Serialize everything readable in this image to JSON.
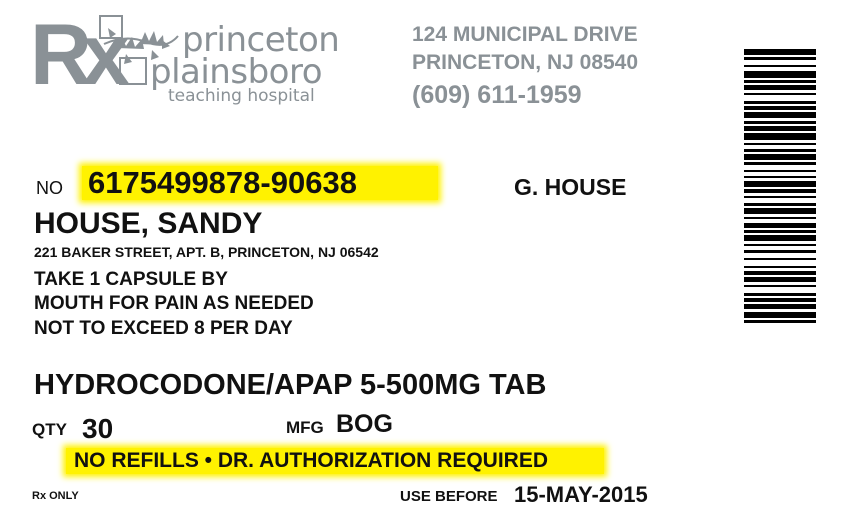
{
  "header": {
    "logo_rx": "Rx",
    "logo_line1": "princeton",
    "logo_line2": "plainsboro",
    "logo_line3": "teaching hospital",
    "address_line1": "124 MUNICIPAL DRIVE",
    "address_line2": "PRINCETON, NJ 08540",
    "phone": "(609) 611-1959"
  },
  "rx": {
    "no_label": "NO",
    "number": "6175499878-90638",
    "doctor": "G. HOUSE",
    "patient_name": "HOUSE, SANDY",
    "patient_address": "221 BAKER STREET, APT. B, PRINCETON, NJ 06542",
    "instructions": [
      "TAKE 1 CAPSULE BY",
      "MOUTH FOR PAIN AS NEEDED",
      "NOT TO EXCEED 8 PER DAY"
    ],
    "drug": "HYDROCODONE/APAP 5-500MG TAB",
    "qty_label": "QTY",
    "qty": "30",
    "mfg_label": "MFG",
    "mfg": "BOG",
    "refill_notice": "NO REFILLS • DR. AUTHORIZATION REQUIRED",
    "rx_only": "Rx ONLY",
    "use_before_label": "USE BEFORE",
    "use_before": "15-MAY-2015"
  },
  "colors": {
    "logo_gray": "#8a9196",
    "highlight": "#fff200",
    "text": "#111111"
  }
}
